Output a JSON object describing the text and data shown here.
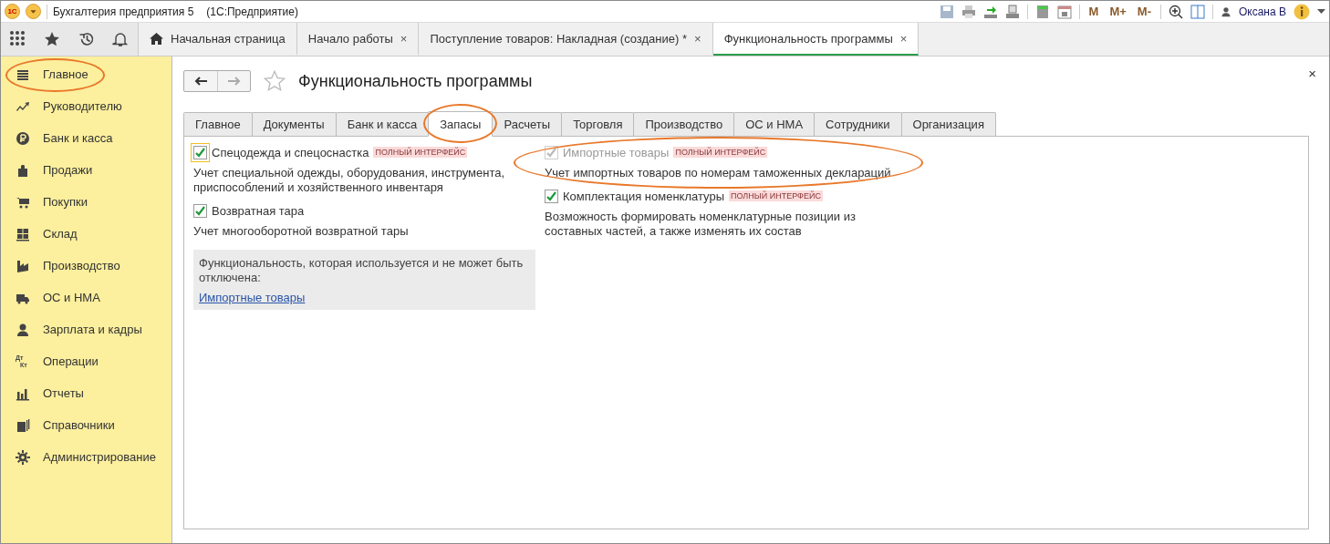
{
  "window": {
    "logo": "1С",
    "title": "Бухгалтерия предприятия 5",
    "subtitle": "(1С:Предприятие)",
    "memory_buttons": [
      "M",
      "M+",
      "M-"
    ],
    "user": "Оксана В"
  },
  "top_tabs": [
    {
      "label": "Начальная страница",
      "kind": "home",
      "selected": false
    },
    {
      "label": "Начало работы",
      "close": "×",
      "kind": "doc",
      "selected": false
    },
    {
      "label": "Поступление товаров: Накладная (создание) *",
      "close": "×",
      "kind": "doc",
      "selected": false
    },
    {
      "label": "Функциональность программы",
      "close": "×",
      "kind": "doc",
      "selected": true
    }
  ],
  "sidebar": {
    "items": [
      {
        "label": "Главное",
        "highlighted": true
      },
      {
        "label": "Руководителю",
        "highlighted": false
      },
      {
        "label": "Банк и касса",
        "highlighted": false
      },
      {
        "label": "Продажи",
        "highlighted": false
      },
      {
        "label": "Покупки",
        "highlighted": false
      },
      {
        "label": "Склад",
        "highlighted": false
      },
      {
        "label": "Производство",
        "highlighted": false
      },
      {
        "label": "ОС и НМА",
        "highlighted": false
      },
      {
        "label": "Зарплата и кадры",
        "highlighted": false
      },
      {
        "label": "Операции",
        "icon_text": [
          "Дт",
          "Кт"
        ],
        "highlighted": false
      },
      {
        "label": "Отчеты",
        "highlighted": false
      },
      {
        "label": "Справочники",
        "highlighted": false
      },
      {
        "label": "Администрирование",
        "highlighted": false
      }
    ]
  },
  "form": {
    "title": "Функциональность программы",
    "close": "×",
    "tabs": [
      {
        "label": "Главное",
        "selected": false,
        "highlighted": false
      },
      {
        "label": "Документы",
        "selected": false,
        "highlighted": false
      },
      {
        "label": "Банк и касса",
        "selected": false,
        "highlighted": false
      },
      {
        "label": "Запасы",
        "selected": true,
        "highlighted": true
      },
      {
        "label": "Расчеты",
        "selected": false,
        "highlighted": false
      },
      {
        "label": "Торговля",
        "selected": false,
        "highlighted": false
      },
      {
        "label": "Производство",
        "selected": false,
        "highlighted": false
      },
      {
        "label": "ОС и НМА",
        "selected": false,
        "highlighted": false
      },
      {
        "label": "Сотрудники",
        "selected": false,
        "highlighted": false
      },
      {
        "label": "Организация",
        "selected": false,
        "highlighted": false
      }
    ],
    "left_options": [
      {
        "label": "Спецодежда и спецоснастка",
        "badge": "ПОЛНЫЙ ИНТЕРФЕЙС",
        "description": "Учет специальной одежды, оборудования, инструмента, приспособлений и хозяйственного инвентаря",
        "checked": true,
        "disabled": false,
        "focused": true,
        "highlighted": false
      },
      {
        "label": "Возвратная тара",
        "description": "Учет многооборотной возвратной тары",
        "checked": true,
        "disabled": false,
        "focused": false,
        "highlighted": false
      }
    ],
    "info_box": {
      "text": "Функциональность, которая используется и не может быть отключена:",
      "link": "Импортные товары"
    },
    "right_options": [
      {
        "label": "Импортные товары",
        "badge": "ПОЛНЫЙ ИНТЕРФЕЙС",
        "description": "Учет импортных товаров по номерам таможенных деклараций",
        "checked": true,
        "disabled": true,
        "focused": false,
        "highlighted": true
      },
      {
        "label": "Комплектация номенклатуры",
        "badge": "ПОЛНЫЙ ИНТЕРФЕЙС",
        "description": "Возможность формировать номенклатурные позиции из составных частей, а также изменять их состав",
        "checked": true,
        "disabled": false,
        "focused": false,
        "highlighted": false
      }
    ]
  }
}
